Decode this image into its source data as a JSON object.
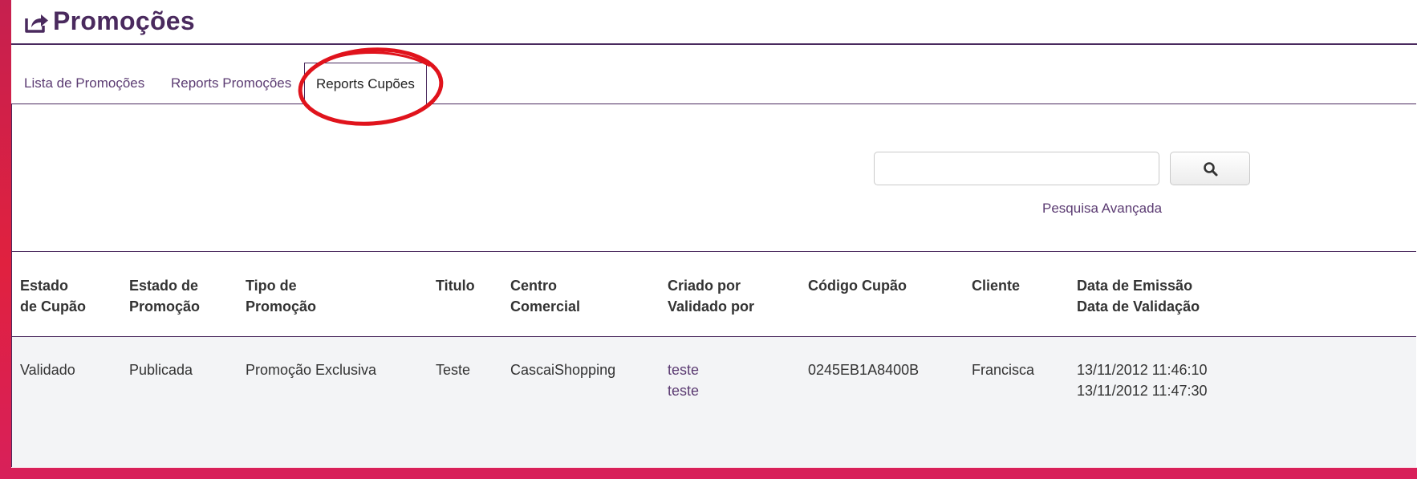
{
  "page": {
    "title": "Promoções",
    "icon": "share-icon"
  },
  "tabs": [
    {
      "label": "Lista de Promoções"
    },
    {
      "label": "Reports Promoções"
    },
    {
      "label": "Reports Cupões"
    }
  ],
  "active_tab": 2,
  "search": {
    "value": "",
    "placeholder": "",
    "button_icon": "search-icon",
    "advanced_label": "Pesquisa Avançada"
  },
  "table": {
    "headers": [
      [
        "Estado",
        "de Cupão"
      ],
      [
        "Estado de",
        "Promoção"
      ],
      [
        "Tipo de",
        "Promoção"
      ],
      [
        "Titulo"
      ],
      [
        "Centro",
        "Comercial"
      ],
      [
        "Criado por",
        "Validado por"
      ],
      [
        "Código Cupão"
      ],
      [
        "Cliente"
      ],
      [
        "Data de Emissão",
        "Data de Validação"
      ]
    ],
    "rows": [
      [
        [
          "Validado"
        ],
        [
          "Publicada"
        ],
        [
          "Promoção Exclusiva"
        ],
        [
          "Teste"
        ],
        [
          "CascaiShopping"
        ],
        [
          "teste",
          "teste"
        ],
        [
          "0245EB1A8400B"
        ],
        [
          "Francisca"
        ],
        [
          "13/11/2012 11:46:10",
          "13/11/2012 11:47:30"
        ]
      ]
    ]
  },
  "colors": {
    "accent": "#4a2a5e",
    "link": "#5b3b72",
    "annotation": "#e0131c",
    "row_bg": "#f3f4f6"
  }
}
